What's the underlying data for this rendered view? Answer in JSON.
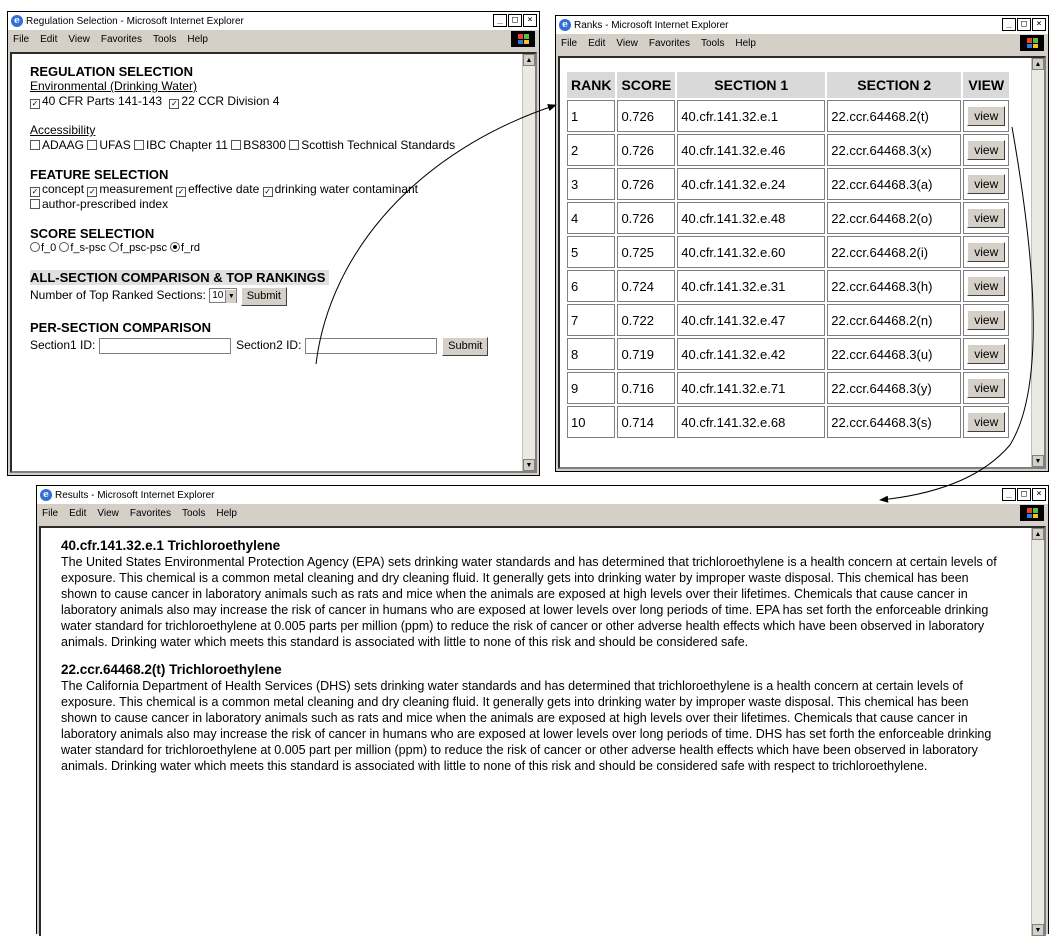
{
  "menu": {
    "file": "File",
    "edit": "Edit",
    "view": "View",
    "favorites": "Favorites",
    "tools": "Tools",
    "help": "Help"
  },
  "win1": {
    "title": "Regulation Selection - Microsoft Internet Explorer",
    "reg_heading": "REGULATION SELECTION",
    "env_link": "Environmental (Drinking Water)",
    "env_opts": [
      "40 CFR Parts 141-143",
      "22 CCR Division 4"
    ],
    "acc_link": "Accessibility",
    "acc_opts": [
      "ADAAG",
      "UFAS",
      "IBC Chapter 11",
      "BS8300",
      "Scottish Technical Standards"
    ],
    "feat_heading": "FEATURE SELECTION",
    "feat_opts": [
      "concept",
      "measurement",
      "effective date",
      "drinking water contaminant",
      "author-prescribed index"
    ],
    "score_heading": "SCORE SELECTION",
    "score_opts": [
      "f_0",
      "f_s-psc",
      "f_psc-psc",
      "f_rd"
    ],
    "all_heading": "ALL-SECTION COMPARISON & TOP RANKINGS",
    "num_label": "Number of Top Ranked Sections:",
    "num_value": "10",
    "submit": "Submit",
    "per_heading": "PER-SECTION COMPARISON",
    "sec1_label": "Section1 ID:",
    "sec2_label": "Section2 ID:",
    "submit2": "Submit"
  },
  "win2": {
    "title": "Ranks - Microsoft Internet Explorer",
    "headers": [
      "RANK",
      "SCORE",
      "SECTION 1",
      "SECTION 2",
      "VIEW"
    ],
    "view_label": "view",
    "rows": [
      [
        "1",
        "0.726",
        "40.cfr.141.32.e.1",
        "22.ccr.64468.2(t)"
      ],
      [
        "2",
        "0.726",
        "40.cfr.141.32.e.46",
        "22.ccr.64468.3(x)"
      ],
      [
        "3",
        "0.726",
        "40.cfr.141.32.e.24",
        "22.ccr.64468.3(a)"
      ],
      [
        "4",
        "0.726",
        "40.cfr.141.32.e.48",
        "22.ccr.64468.2(o)"
      ],
      [
        "5",
        "0.725",
        "40.cfr.141.32.e.60",
        "22.ccr.64468.2(i)"
      ],
      [
        "6",
        "0.724",
        "40.cfr.141.32.e.31",
        "22.ccr.64468.3(h)"
      ],
      [
        "7",
        "0.722",
        "40.cfr.141.32.e.47",
        "22.ccr.64468.2(n)"
      ],
      [
        "8",
        "0.719",
        "40.cfr.141.32.e.42",
        "22.ccr.64468.3(u)"
      ],
      [
        "9",
        "0.716",
        "40.cfr.141.32.e.71",
        "22.ccr.64468.3(y)"
      ],
      [
        "10",
        "0.714",
        "40.cfr.141.32.e.68",
        "22.ccr.64468.3(s)"
      ]
    ]
  },
  "win3": {
    "title": "Results - Microsoft Internet Explorer",
    "sec1_title": "40.cfr.141.32.e.1 Trichloroethylene",
    "sec1_body": "The United States Environmental Protection Agency (EPA) sets drinking water standards and has determined that trichloroethylene is a health concern at certain levels of exposure. This chemical is a common metal cleaning and dry cleaning fluid. It generally gets into drinking water by improper waste disposal. This chemical has been shown to cause cancer in laboratory animals such as rats and mice when the animals are exposed at high levels over their lifetimes. Chemicals that cause cancer in laboratory animals also may increase the risk of cancer in humans who are exposed at lower levels over long periods of time. EPA has set forth the enforceable drinking water standard for trichloroethylene at 0.005 parts per million (ppm) to reduce the risk of cancer or other adverse health effects which have been observed in laboratory animals. Drinking water which meets this standard is associated with little to none of this risk and should be considered safe.",
    "sec2_title": "22.ccr.64468.2(t) Trichloroethylene",
    "sec2_body": "The California Department of Health Services (DHS) sets drinking water standards and has determined that trichloroethylene is a health concern at certain levels of exposure. This chemical is a common metal cleaning and dry cleaning fluid. It generally gets into drinking water by improper waste disposal. This chemical has been shown to cause cancer in laboratory animals such as rats and mice when the animals are exposed at high levels over their lifetimes. Chemicals that cause cancer in laboratory animals also may increase the risk of cancer in humans who are exposed at lower levels over long periods of time. DHS has set forth the enforceable drinking water standard for trichloroethylene at 0.005 part per million (ppm) to reduce the risk of cancer or other adverse health effects which have been observed in laboratory animals. Drinking water which meets this standard is associated with little to none of this risk and should be considered safe with respect to trichloroethylene."
  }
}
